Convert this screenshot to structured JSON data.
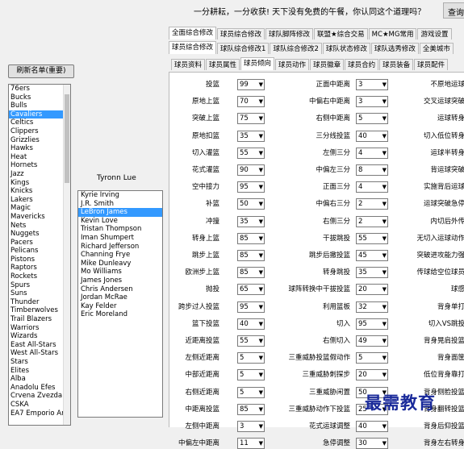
{
  "topbar": {
    "slogan": "一分耕耘，一分收获! 天下没有免费的午餐，你认同这个道理吗？",
    "query_button": "查询"
  },
  "sidebar": {
    "refresh_button": "刷新名单(重要)",
    "teams": [
      "76ers",
      "Bucks",
      "Bulls",
      "Cavaliers",
      "Celtics",
      "Clippers",
      "Grizzlies",
      "Hawks",
      "Heat",
      "Hornets",
      "Jazz",
      "Kings",
      "Knicks",
      "Lakers",
      "Magic",
      "Mavericks",
      "Nets",
      "Nuggets",
      "Pacers",
      "Pelicans",
      "Pistons",
      "Raptors",
      "Rockets",
      "Spurs",
      "Suns",
      "Thunder",
      "Timberwolves",
      "Trail Blazers",
      "Warriors",
      "Wizards",
      "East All-Stars",
      "West All-Stars",
      "Stars",
      "Elites",
      "Alba",
      "Anadolu Efes",
      "Crvena Zvezda T",
      "CSKA",
      "EA7 Emporio Ar"
    ],
    "selected_team": "Cavaliers"
  },
  "coach": {
    "name": "Tyronn Lue"
  },
  "players": {
    "items": [
      "Kyrie Irving",
      "J.R. Smith",
      "LeBron James",
      "Kevin Love",
      "Tristan Thompson",
      "Iman Shumpert",
      "Richard Jefferson",
      "Channing Frye",
      "Mike Dunleavy",
      "Mo Williams",
      "James Jones",
      "Chris Andersen",
      "Jordan McRae",
      "Kay Felder",
      "Eric Moreland"
    ],
    "selected": "LeBron James"
  },
  "tabs_row1": [
    "全面综合修改",
    "球员综合修改",
    "球队脚阵修改",
    "联盟★综合交易",
    "MC★MG常用",
    "游戏设置"
  ],
  "tabs_row1_active": 0,
  "tabs_row2": [
    "球员综合修改",
    "球队综合修改1",
    "球队综合修改2",
    "球队状态修改",
    "球队选秀修改",
    "全美城市"
  ],
  "tabs_row2_active": 0,
  "tabs_row3": [
    "球员资料",
    "球员属性",
    "球员倾向",
    "球员动作",
    "球员徽章",
    "球员合约",
    "球员装备",
    "球员配件"
  ],
  "tabs_row3_active": 2,
  "col1": [
    {
      "label": "投篮",
      "value": "99"
    },
    {
      "label": "原地上篮",
      "value": "70"
    },
    {
      "label": "突破上篮",
      "value": "75"
    },
    {
      "label": "原地扣篮",
      "value": "35"
    },
    {
      "label": "切入灌篮",
      "value": "55"
    },
    {
      "label": "花式灌篮",
      "value": "90"
    },
    {
      "label": "空中接力",
      "value": "95"
    },
    {
      "label": "补篮",
      "value": "50"
    },
    {
      "label": "冲撞",
      "value": "35"
    },
    {
      "label": "转身上篮",
      "value": "85"
    },
    {
      "label": "跳步上篮",
      "value": "85"
    },
    {
      "label": "欧洲步上篮",
      "value": "85"
    },
    {
      "label": "抛投",
      "value": "65"
    },
    {
      "label": "跨步过人投篮",
      "value": "95"
    },
    {
      "label": "篮下投篮",
      "value": "40"
    },
    {
      "label": "近距离投篮",
      "value": "55"
    },
    {
      "label": "左侧近距离",
      "value": "5"
    },
    {
      "label": "中部近距离",
      "value": "5"
    },
    {
      "label": "右侧近距离",
      "value": "5"
    },
    {
      "label": "中距离投篮",
      "value": "85"
    },
    {
      "label": "左侧中距离",
      "value": "3"
    },
    {
      "label": "中偏左中距离",
      "value": "11"
    }
  ],
  "col2": [
    {
      "label": "正面中距离",
      "value": "3"
    },
    {
      "label": "中偏右中距离",
      "value": "3"
    },
    {
      "label": "右侧中距离",
      "value": "5"
    },
    {
      "label": "三分线投篮",
      "value": "40"
    },
    {
      "label": "左侧三分",
      "value": "4"
    },
    {
      "label": "中偏左三分",
      "value": "8"
    },
    {
      "label": "正面三分",
      "value": "4"
    },
    {
      "label": "中偏右三分",
      "value": "2"
    },
    {
      "label": "右侧三分",
      "value": "2"
    },
    {
      "label": "干拔跳投",
      "value": "55"
    },
    {
      "label": "跳步后撤投篮",
      "value": "45"
    },
    {
      "label": "转身跳投",
      "value": "35"
    },
    {
      "label": "球阵转换中干拔投篮",
      "value": "20"
    },
    {
      "label": "利用篮板",
      "value": "32"
    },
    {
      "label": "切入",
      "value": "95"
    },
    {
      "label": "右侧切入",
      "value": "49"
    },
    {
      "label": "三重威胁投篮假动作",
      "value": "5"
    },
    {
      "label": "三重威胁刺探步",
      "value": "20"
    },
    {
      "label": "三重威胁闲置",
      "value": "50"
    },
    {
      "label": "三重威胁动作下投篮",
      "value": "25"
    },
    {
      "label": "花式运球调整",
      "value": "40"
    },
    {
      "label": "急停调整",
      "value": "30"
    }
  ],
  "col3": [
    "不原地运球",
    "交叉运球突破",
    "运球转身",
    "切入低位转身",
    "运球半转身",
    "背运球突破",
    "实施背后运球",
    "运球突破急停",
    "内切后外传",
    "无切入运球动作",
    "突破进攻能力强",
    "传球给空位球员",
    "球感",
    "背身单打",
    "切入VS跳投",
    "背身晃肩投篮",
    "背身面筐",
    "低位背身靠打",
    "背身侧脸投篮",
    "背身翻转投篮",
    "背身后仰投篮",
    "背身左右转身"
  ],
  "watermark": "最需教育"
}
